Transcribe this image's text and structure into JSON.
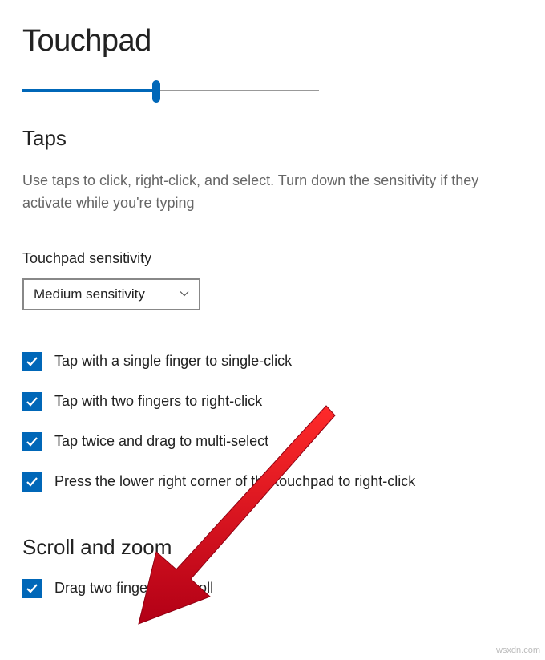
{
  "page": {
    "title": "Touchpad"
  },
  "slider": {
    "percent": 45
  },
  "taps": {
    "heading": "Taps",
    "description": "Use taps to click, right-click, and select. Turn down the sensitivity if they activate while you're typing",
    "sensitivity_label": "Touchpad sensitivity",
    "sensitivity_value": "Medium sensitivity",
    "checkboxes": [
      {
        "label": "Tap with a single finger to single-click",
        "checked": true
      },
      {
        "label": "Tap with two fingers to right-click",
        "checked": true
      },
      {
        "label": "Tap twice and drag to multi-select",
        "checked": true
      },
      {
        "label": "Press the lower right corner of the touchpad to right-click",
        "checked": true
      }
    ]
  },
  "scroll": {
    "heading": "Scroll and zoom",
    "checkboxes": [
      {
        "label": "Drag two fingers to scroll",
        "checked": true
      }
    ]
  },
  "colors": {
    "accent": "#0067b8",
    "arrow": "#d6001c"
  },
  "watermark": "wsxdn.com"
}
